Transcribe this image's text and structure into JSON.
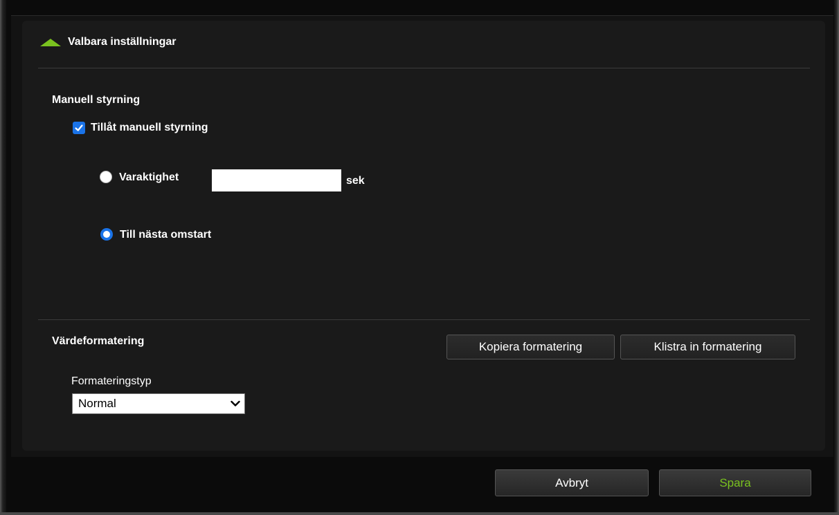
{
  "section": {
    "title": "Valbara inställningar"
  },
  "manual": {
    "heading": "Manuell styrning",
    "allow_label": "Tillåt manuell styrning",
    "allow_checked": true,
    "duration_label": "Varaktighet",
    "duration_value": "",
    "duration_unit": "sek",
    "restart_label": "Till nästa omstart",
    "selected_option": "restart"
  },
  "formatting": {
    "heading": "Värdeformatering",
    "copy_button": "Kopiera formatering",
    "paste_button": "Klistra in formatering",
    "type_label": "Formateringstyp",
    "type_value": "Normal"
  },
  "footer": {
    "cancel_label": "Avbryt",
    "save_label": "Spara"
  },
  "colors": {
    "accent_green": "#7ac21f",
    "accent_blue": "#1a73e8"
  }
}
